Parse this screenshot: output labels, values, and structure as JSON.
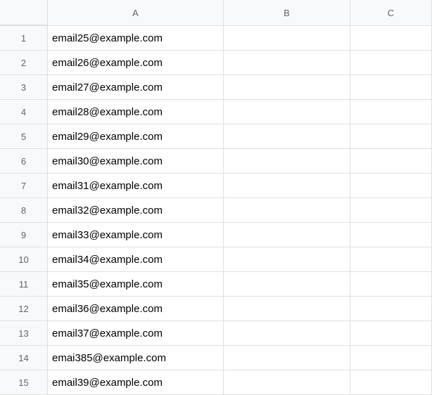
{
  "columns": [
    {
      "id": "A",
      "label": "A"
    },
    {
      "id": "B",
      "label": "B"
    },
    {
      "id": "C",
      "label": "C"
    }
  ],
  "rows": [
    {
      "num": "1",
      "A": "email25@example.com",
      "B": "",
      "C": ""
    },
    {
      "num": "2",
      "A": "email26@example.com",
      "B": "",
      "C": ""
    },
    {
      "num": "3",
      "A": "email27@example.com",
      "B": "",
      "C": ""
    },
    {
      "num": "4",
      "A": "email28@example.com",
      "B": "",
      "C": ""
    },
    {
      "num": "5",
      "A": "email29@example.com",
      "B": "",
      "C": ""
    },
    {
      "num": "6",
      "A": "email30@example.com",
      "B": "",
      "C": ""
    },
    {
      "num": "7",
      "A": "email31@example.com",
      "B": "",
      "C": ""
    },
    {
      "num": "8",
      "A": "email32@example.com",
      "B": "",
      "C": ""
    },
    {
      "num": "9",
      "A": "email33@example.com",
      "B": "",
      "C": ""
    },
    {
      "num": "10",
      "A": "email34@example.com",
      "B": "",
      "C": ""
    },
    {
      "num": "11",
      "A": "email35@example.com",
      "B": "",
      "C": ""
    },
    {
      "num": "12",
      "A": "email36@example.com",
      "B": "",
      "C": ""
    },
    {
      "num": "13",
      "A": "email37@example.com",
      "B": "",
      "C": ""
    },
    {
      "num": "14",
      "A": "emai385@example.com",
      "B": "",
      "C": ""
    },
    {
      "num": "15",
      "A": "email39@example.com",
      "B": "",
      "C": ""
    }
  ]
}
